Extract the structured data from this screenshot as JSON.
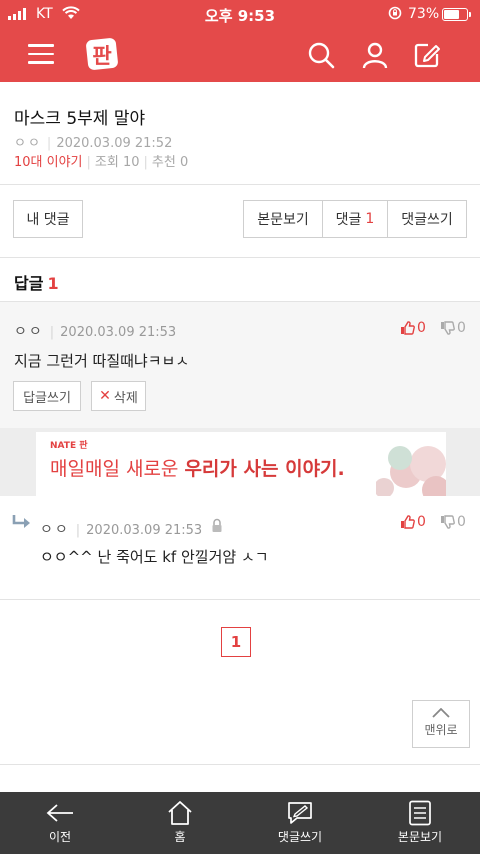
{
  "status_bar": {
    "carrier": "KT",
    "time": "오후 9:53",
    "battery": "73%",
    "battery_level": 0.73
  },
  "app": {
    "logo_text": "판",
    "accent": "#e44a4a"
  },
  "post": {
    "title": "마스크 5부제 말야",
    "author": "ㅇㅇ",
    "date": "2020.03.09 21:52",
    "category": "10대 이야기",
    "views": "조회 10",
    "recommend": "추천 0"
  },
  "actions": {
    "my_comments": "내 댓글",
    "view_post": "본문보기",
    "comments_label": "댓글",
    "comments_count": "1",
    "write_comment": "댓글쓰기"
  },
  "replies": {
    "heading": "답글",
    "count": "1",
    "comment": {
      "nick": "ㅇㅇ",
      "date": "2020.03.09 21:53",
      "text": "지금 그런거 따질때냐ㅋㅂㅅ",
      "likes": "0",
      "dislikes": "0",
      "reply_btn": "답글쓰기",
      "delete_btn": "삭제"
    },
    "subreply": {
      "nick": "ㅇㅇ",
      "date": "2020.03.09 21:53",
      "text": "ㅇㅇ^^ 난 죽어도 kf 안낄거얌 ㅅㄱ",
      "likes": "0",
      "dislikes": "0"
    }
  },
  "ad": {
    "brand": "NATE 판",
    "copy_plain": "매일매일 새로운 ",
    "copy_bold": "우리가 사는 이야기."
  },
  "pagination": {
    "current": "1"
  },
  "top_button": "맨위로",
  "bottom_nav": [
    {
      "label": "이전",
      "icon": "back-arrow-icon"
    },
    {
      "label": "홈",
      "icon": "home-icon"
    },
    {
      "label": "댓글쓰기",
      "icon": "comment-write-icon"
    },
    {
      "label": "본문보기",
      "icon": "document-icon"
    }
  ]
}
